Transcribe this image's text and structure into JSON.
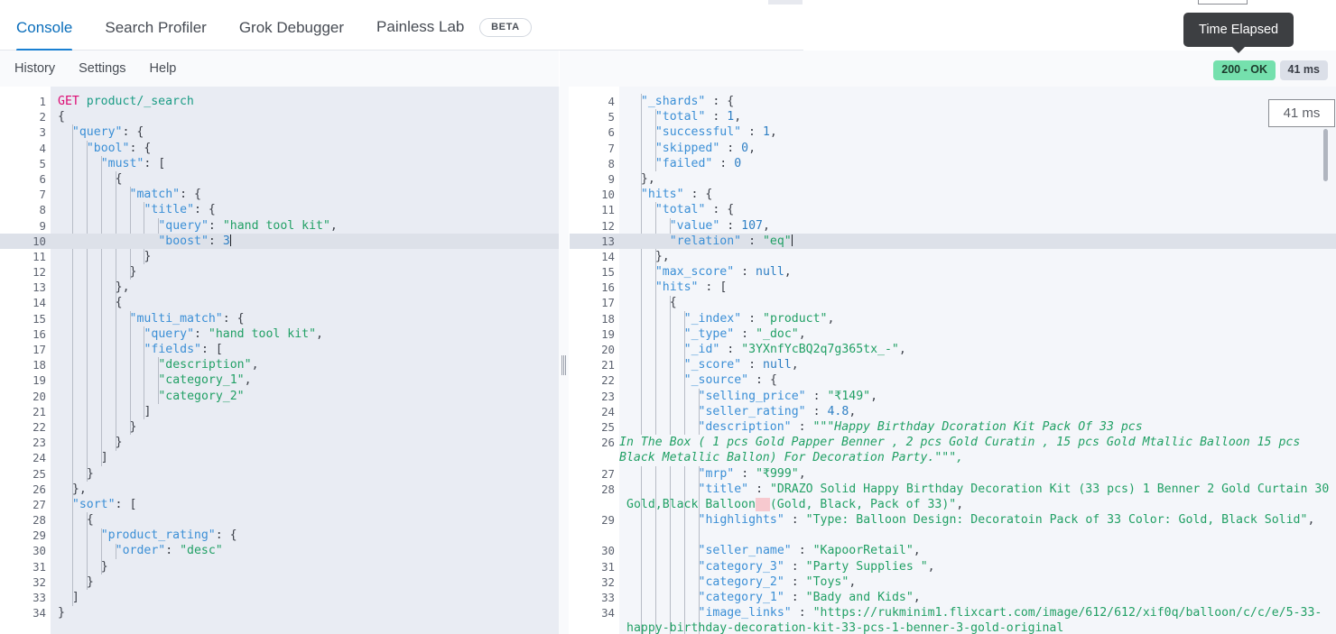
{
  "app": {
    "name": "Kibana Dev Tools Console"
  },
  "tabs": [
    {
      "label": "Console",
      "active": true
    },
    {
      "label": "Search Profiler",
      "active": false
    },
    {
      "label": "Grok Debugger",
      "active": false
    },
    {
      "label": "Painless Lab",
      "active": false,
      "badge": "BETA"
    }
  ],
  "submenu": [
    {
      "label": "History"
    },
    {
      "label": "Settings"
    },
    {
      "label": "Help"
    }
  ],
  "status": {
    "http_status": "200 - OK",
    "elapsed": "41 ms",
    "elapsed_popup": "41 ms",
    "status_color": "#75e0ad",
    "elapsed_color": "#dbdfe8"
  },
  "tooltip": {
    "text": "Time Elapsed"
  },
  "request_editor": {
    "first_line_number": 1,
    "highlighted_line": 10,
    "lines": [
      {
        "n": 1,
        "fold": "",
        "text": "GET product/_search",
        "kind": "request"
      },
      {
        "n": 2,
        "fold": "v",
        "text": "{"
      },
      {
        "n": 3,
        "fold": "v",
        "text": "  \"query\": {"
      },
      {
        "n": 4,
        "fold": "v",
        "text": "    \"bool\": {"
      },
      {
        "n": 5,
        "fold": "v",
        "text": "      \"must\": ["
      },
      {
        "n": 6,
        "fold": "v",
        "text": "        {"
      },
      {
        "n": 7,
        "fold": "v",
        "text": "          \"match\": {"
      },
      {
        "n": 8,
        "fold": "v",
        "text": "            \"title\": {"
      },
      {
        "n": 9,
        "fold": "",
        "text": "              \"query\": \"hand tool kit\","
      },
      {
        "n": 10,
        "fold": "",
        "text": "              \"boost\": 3",
        "caret": true
      },
      {
        "n": 11,
        "fold": "^",
        "text": "            }"
      },
      {
        "n": 12,
        "fold": "^",
        "text": "          }"
      },
      {
        "n": 13,
        "fold": "^",
        "text": "        },"
      },
      {
        "n": 14,
        "fold": "v",
        "text": "        {"
      },
      {
        "n": 15,
        "fold": "v",
        "text": "          \"multi_match\": {"
      },
      {
        "n": 16,
        "fold": "",
        "text": "            \"query\": \"hand tool kit\","
      },
      {
        "n": 17,
        "fold": "v",
        "text": "            \"fields\": ["
      },
      {
        "n": 18,
        "fold": "",
        "text": "              \"description\","
      },
      {
        "n": 19,
        "fold": "",
        "text": "              \"category_1\","
      },
      {
        "n": 20,
        "fold": "",
        "text": "              \"category_2\""
      },
      {
        "n": 21,
        "fold": "^",
        "text": "            ]"
      },
      {
        "n": 22,
        "fold": "^",
        "text": "          }"
      },
      {
        "n": 23,
        "fold": "^",
        "text": "        }"
      },
      {
        "n": 24,
        "fold": "^",
        "text": "      ]"
      },
      {
        "n": 25,
        "fold": "^",
        "text": "    }"
      },
      {
        "n": 26,
        "fold": "^",
        "text": "  },"
      },
      {
        "n": 27,
        "fold": "v",
        "text": "  \"sort\": ["
      },
      {
        "n": 28,
        "fold": "v",
        "text": "    {"
      },
      {
        "n": 29,
        "fold": "v",
        "text": "      \"product_rating\": {"
      },
      {
        "n": 30,
        "fold": "",
        "text": "        \"order\": \"desc\""
      },
      {
        "n": 31,
        "fold": "^",
        "text": "      }"
      },
      {
        "n": 32,
        "fold": "^",
        "text": "    }"
      },
      {
        "n": 33,
        "fold": "^",
        "text": "  ]"
      },
      {
        "n": 34,
        "fold": "^",
        "text": "}"
      }
    ]
  },
  "response_editor": {
    "highlighted_line": 13,
    "lines": [
      {
        "n": 4,
        "fold": "v",
        "text": "  \"_shards\" : {"
      },
      {
        "n": 5,
        "fold": "",
        "text": "    \"total\" : 1,"
      },
      {
        "n": 6,
        "fold": "",
        "text": "    \"successful\" : 1,"
      },
      {
        "n": 7,
        "fold": "",
        "text": "    \"skipped\" : 0,"
      },
      {
        "n": 8,
        "fold": "",
        "text": "    \"failed\" : 0"
      },
      {
        "n": 9,
        "fold": "^",
        "text": "  },"
      },
      {
        "n": 10,
        "fold": "v",
        "text": "  \"hits\" : {"
      },
      {
        "n": 11,
        "fold": "v",
        "text": "    \"total\" : {"
      },
      {
        "n": 12,
        "fold": "",
        "text": "      \"value\" : 107,"
      },
      {
        "n": 13,
        "fold": "",
        "text": "      \"relation\" : \"eq\"",
        "caret": true
      },
      {
        "n": 14,
        "fold": "^",
        "text": "    },"
      },
      {
        "n": 15,
        "fold": "",
        "text": "    \"max_score\" : null,"
      },
      {
        "n": 16,
        "fold": "v",
        "text": "    \"hits\" : ["
      },
      {
        "n": 17,
        "fold": "v",
        "text": "      {"
      },
      {
        "n": 18,
        "fold": "",
        "text": "        \"_index\" : \"product\","
      },
      {
        "n": 19,
        "fold": "",
        "text": "        \"_type\" : \"_doc\","
      },
      {
        "n": 20,
        "fold": "",
        "text": "        \"_id\" : \"3YXnfYcBQ2q7g365tx_-\","
      },
      {
        "n": 21,
        "fold": "",
        "text": "        \"_score\" : null,"
      },
      {
        "n": 22,
        "fold": "v",
        "text": "        \"_source\" : {"
      },
      {
        "n": 23,
        "fold": "",
        "text": "          \"selling_price\" : \"₹149\","
      },
      {
        "n": 24,
        "fold": "",
        "text": "          \"seller_rating\" : 4.8,"
      },
      {
        "n": 25,
        "fold": "",
        "text": "          \"description\" : \"\"\"Happy Birthday Dcoration Kit Pack Of 33 pcs"
      },
      {
        "n": 26,
        "fold": "",
        "text": "In The Box ( 1 pcs Gold Papper Benner , 2 pcs Gold Curatin , 15 pcs Gold Mtallic Balloon 15 pcs Black Metallic Ballon) For Decoration Party.\"\"\","
      },
      {
        "n": 27,
        "fold": "",
        "text": "          \"mrp\" : \"₹999\","
      },
      {
        "n": 28,
        "fold": "",
        "text": "          \"title\" : \"DRAZO Solid Happy Birthday Decoration Kit (33 pcs) 1 Benner 2 Gold Curtain 30 Gold,Black Balloon  (Gold, Black, Pack of 33)\","
      },
      {
        "n": 29,
        "fold": "",
        "text": "          \"highlights\" : \"Type: Balloon Design: Decoratoin Pack of 33 Color: Gold, Black Solid\","
      },
      {
        "n": 30,
        "fold": "",
        "text": "          \"seller_name\" : \"KapoorRetail\","
      },
      {
        "n": 31,
        "fold": "",
        "text": "          \"category_3\" : \"Party Supplies \","
      },
      {
        "n": 32,
        "fold": "",
        "text": "          \"category_2\" : \"Toys\","
      },
      {
        "n": 33,
        "fold": "",
        "text": "          \"category_1\" : \"Bady and Kids\","
      },
      {
        "n": 34,
        "fold": "",
        "text": "          \"image_links\" : \"https://rukminim1.flixcart.com/image/612/612/xif0q/balloon/c/c/e/5-33-happy-birthday-decoration-kit-33-pcs-1-benner-3-gold-original"
      }
    ]
  },
  "icons": {
    "fold_open": "▾",
    "fold_closed": "▴",
    "splitter": "resize-handle-icon"
  }
}
